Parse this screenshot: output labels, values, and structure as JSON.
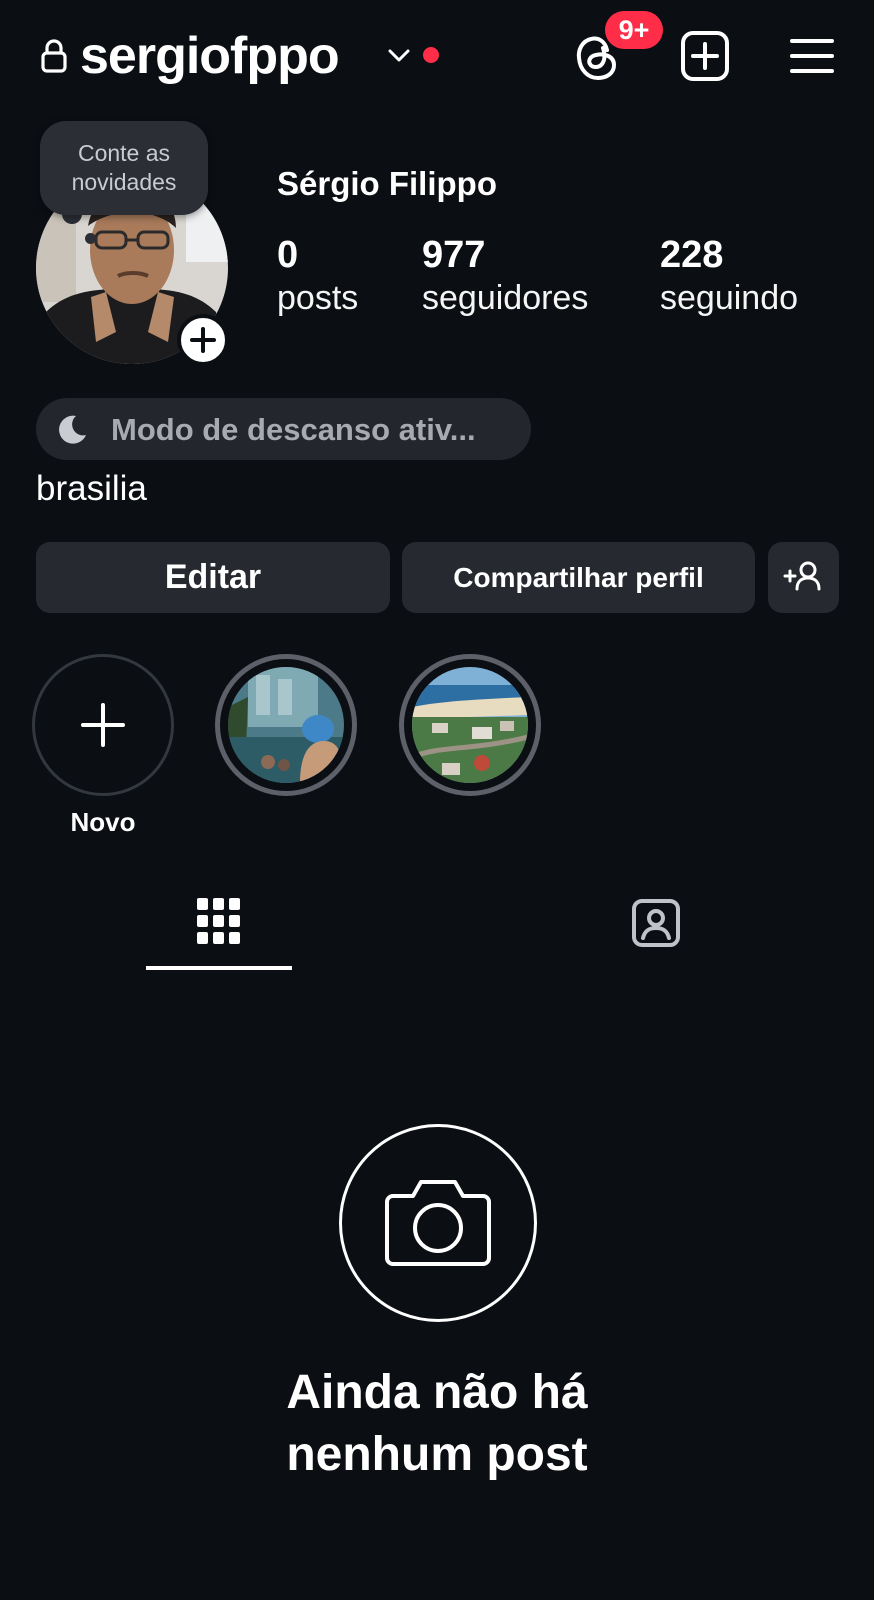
{
  "header": {
    "username": "sergiofppo",
    "notification_badge": "9+",
    "accent_red": "#ff2d48"
  },
  "profile": {
    "note": "Conte as novidades",
    "full_name": "Sérgio Filippo",
    "stats": [
      {
        "value": "0",
        "label": "posts"
      },
      {
        "value": "977",
        "label": "seguidores"
      },
      {
        "value": "228",
        "label": "seguindo"
      }
    ],
    "rest_mode": "Modo de descanso ativ...",
    "bio": "brasilia"
  },
  "actions": {
    "edit_label": "Editar",
    "share_label": "Compartilhar perfil"
  },
  "highlights": {
    "new_label": "Novo"
  },
  "tabs": {
    "icons": [
      "grid-icon",
      "tagged-icon"
    ],
    "active": "grid"
  },
  "empty_state": {
    "title_line1": "Ainda não há",
    "title_line2": "nenhum post"
  },
  "colors": {
    "background": "#0b0e13",
    "button_bg": "#262a30"
  }
}
